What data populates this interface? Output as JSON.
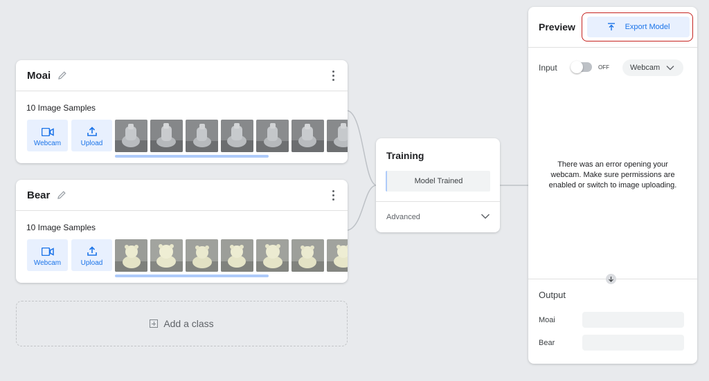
{
  "classes": [
    {
      "name": "Moai",
      "samples_label": "10 Image Samples",
      "webcam_label": "Webcam",
      "upload_label": "Upload",
      "thumbnail_subject": "moai-statue"
    },
    {
      "name": "Bear",
      "samples_label": "10 Image Samples",
      "webcam_label": "Webcam",
      "upload_label": "Upload",
      "thumbnail_subject": "teddy-bear"
    }
  ],
  "add_class_label": "Add a class",
  "training": {
    "title": "Training",
    "button_label": "Model Trained",
    "advanced_label": "Advanced"
  },
  "preview": {
    "title": "Preview",
    "export_label": "Export Model",
    "input_label": "Input",
    "toggle_state": "OFF",
    "source_select": "Webcam",
    "error_message": "There was an error opening your webcam. Make sure permissions are enabled or switch to image uploading.",
    "output_title": "Output",
    "outputs": [
      {
        "label": "Moai"
      },
      {
        "label": "Bear"
      }
    ]
  },
  "colors": {
    "accent": "#1a73e8",
    "accent_light": "#e8f0fe",
    "highlight_outline": "#c5221f",
    "background": "#e8eaed"
  }
}
